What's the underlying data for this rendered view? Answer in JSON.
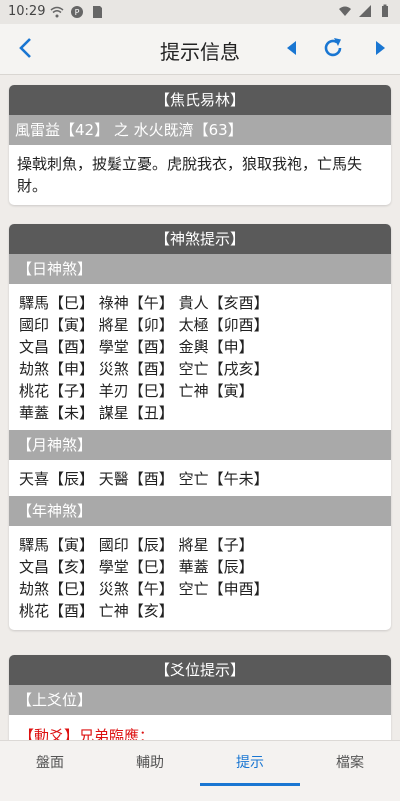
{
  "status": {
    "time": "10:29"
  },
  "appbar": {
    "title": "提示信息"
  },
  "jiao": {
    "header": "【焦氏易林】",
    "subheader": "風雷益【42】 之 水火既濟【63】",
    "text": "操戟刺魚，披髮立憂。虎脫我衣，狼取我袍，亡馬失財。"
  },
  "shensha": {
    "header": "【神煞提示】",
    "day": {
      "label": "【日神煞】",
      "rows": [
        [
          "驛馬【巳】",
          "祿神【午】",
          "貴人【亥酉】"
        ],
        [
          "國印【寅】",
          "將星【卯】",
          "太極【卯酉】"
        ],
        [
          "文昌【酉】",
          "學堂【酉】",
          "金輿【申】"
        ],
        [
          "劫煞【申】",
          "災煞【酉】",
          "空亡【戌亥】"
        ],
        [
          "桃花【子】",
          "羊刃【巳】",
          "亡神【寅】"
        ],
        [
          "華蓋【未】",
          "謀星【丑】"
        ]
      ]
    },
    "month": {
      "label": "【月神煞】",
      "rows": [
        [
          "天喜【辰】",
          "天醫【酉】",
          "空亡【午未】"
        ]
      ]
    },
    "year": {
      "label": "【年神煞】",
      "rows": [
        [
          "驛馬【寅】",
          "國印【辰】",
          "將星【子】"
        ],
        [
          "文昌【亥】",
          "學堂【巳】",
          "華蓋【辰】"
        ],
        [
          "劫煞【巳】",
          "災煞【午】",
          "空亡【申酉】"
        ],
        [
          "桃花【酉】",
          "亡神【亥】"
        ]
      ]
    }
  },
  "yao": {
    "header": "【爻位提示】",
    "sub": "【上爻位】",
    "partial": "【動爻】兄弟臨應："
  },
  "nav": {
    "items": [
      "盤面",
      "輔助",
      "提示",
      "檔案"
    ],
    "active": "提示"
  },
  "colors": {
    "accent": "#1976d2",
    "header_dark": "#5a5a5a",
    "subheader": "#a9a9a9"
  }
}
